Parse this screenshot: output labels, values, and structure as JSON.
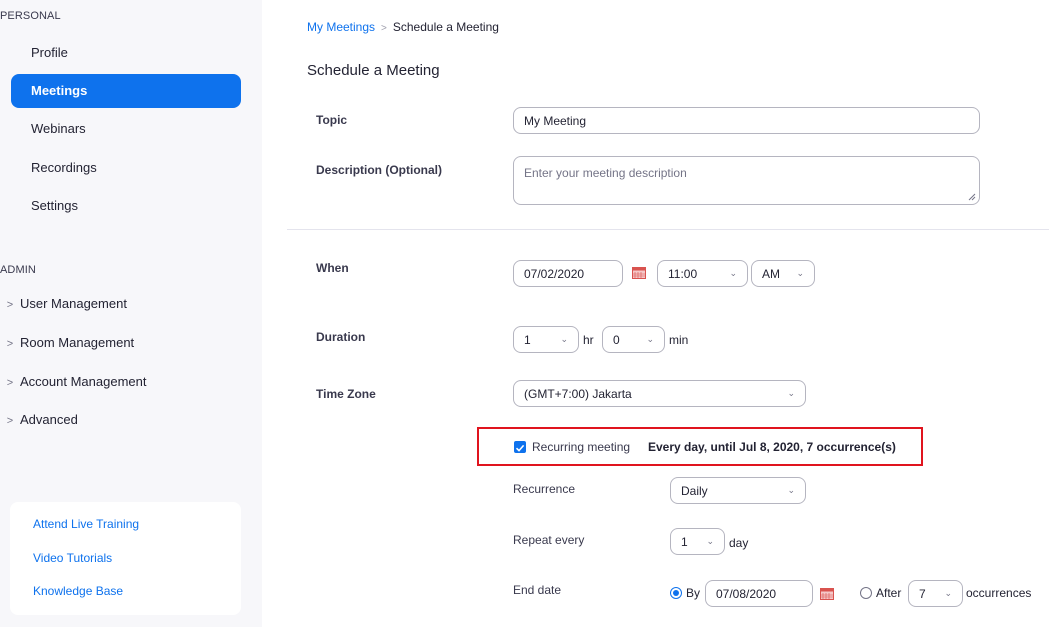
{
  "sidebar": {
    "personal_label": "PERSONAL",
    "items": [
      {
        "label": "Profile"
      },
      {
        "label": "Meetings"
      },
      {
        "label": "Webinars"
      },
      {
        "label": "Recordings"
      },
      {
        "label": "Settings"
      }
    ],
    "admin_label": "ADMIN",
    "admin_items": [
      {
        "label": "User Management"
      },
      {
        "label": "Room Management"
      },
      {
        "label": "Account Management"
      },
      {
        "label": "Advanced"
      }
    ],
    "help_links": [
      {
        "label": "Attend Live Training"
      },
      {
        "label": "Video Tutorials"
      },
      {
        "label": "Knowledge Base"
      }
    ]
  },
  "breadcrumb": {
    "parent": "My Meetings",
    "separator": ">",
    "current": "Schedule a Meeting"
  },
  "page_title": "Schedule a Meeting",
  "form": {
    "topic_label": "Topic",
    "topic_value": "My Meeting",
    "description_label": "Description (Optional)",
    "description_placeholder": "Enter your meeting description",
    "when_label": "When",
    "date_value": "07/02/2020",
    "time_value": "11:00",
    "ampm_value": "AM",
    "duration_label": "Duration",
    "duration_hr_value": "1",
    "hr_unit": "hr",
    "duration_min_value": "0",
    "min_unit": "min",
    "timezone_label": "Time Zone",
    "timezone_value": "(GMT+7:00) Jakarta",
    "recurring_label": "Recurring meeting",
    "recurring_checked": true,
    "recurring_summary": "Every day, until Jul 8, 2020, 7 occurrence(s)",
    "recurrence_label": "Recurrence",
    "recurrence_value": "Daily",
    "repeat_label": "Repeat every",
    "repeat_value": "1",
    "repeat_unit": "day",
    "end_date_label": "End date",
    "end_by_label": "By",
    "end_by_value": "07/08/2020",
    "end_after_label": "After",
    "end_after_value": "7",
    "end_after_unit": "occurrences"
  },
  "colors": {
    "accent": "#0e72ed",
    "highlight_border": "#e0141e",
    "sidebar_bg": "#f7f7fa"
  }
}
